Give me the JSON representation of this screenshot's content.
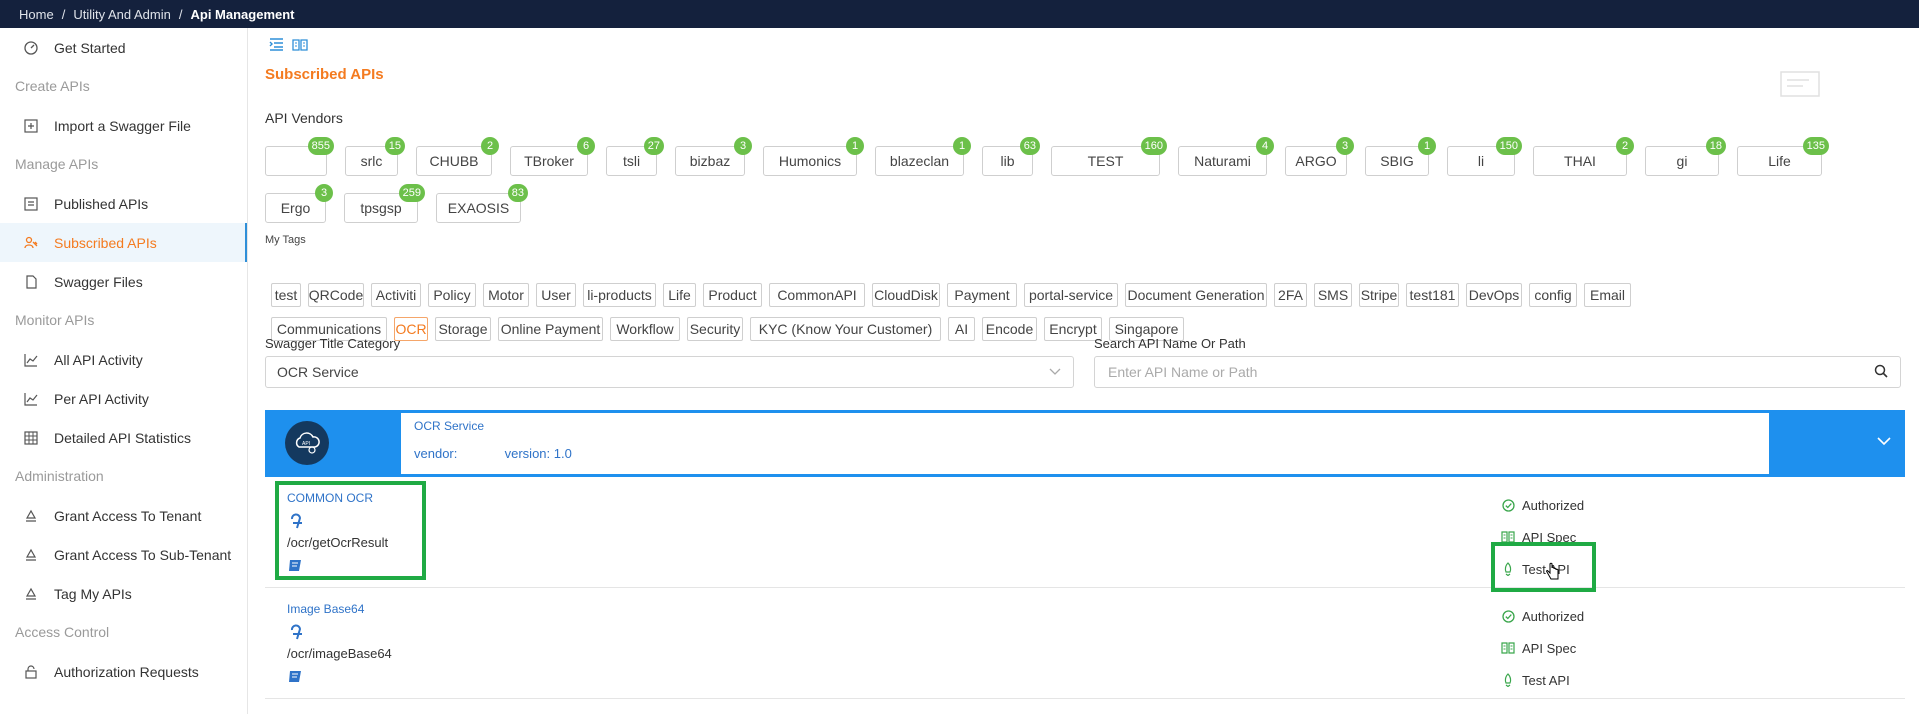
{
  "breadcrumb": {
    "items": [
      "Home",
      "Utility And Admin"
    ],
    "current": "Api Management",
    "separator": "/"
  },
  "sidebar": {
    "get_started": "Get Started",
    "sections": {
      "create": "Create APIs",
      "manage": "Manage APIs",
      "monitor": "Monitor APIs",
      "admin": "Administration",
      "access": "Access Control"
    },
    "items": {
      "import_swagger": "Import a Swagger File",
      "published": "Published APIs",
      "subscribed": "Subscribed APIs",
      "swagger_files": "Swagger Files",
      "all_activity": "All API Activity",
      "per_activity": "Per API Activity",
      "detailed_stats": "Detailed API Statistics",
      "grant_tenant": "Grant Access To Tenant",
      "grant_subtenant": "Grant Access To Sub-Tenant",
      "tag_apis": "Tag My APIs",
      "auth_requests": "Authorization Requests"
    },
    "active_item": "Subscribed APIs"
  },
  "main": {
    "title": "Subscribed APIs",
    "vendors_label": "API Vendors",
    "tags_label": "My Tags",
    "category_label": "Swagger Title Category",
    "category_value": "OCR Service",
    "search_label": "Search API Name Or Path",
    "search_placeholder": "Enter API Name or Path"
  },
  "vendors": [
    {
      "name": "",
      "count": "855"
    },
    {
      "name": "srlc",
      "count": "15"
    },
    {
      "name": "CHUBB",
      "count": "2"
    },
    {
      "name": "TBroker",
      "count": "6"
    },
    {
      "name": "tsli",
      "count": "27"
    },
    {
      "name": "bizbaz",
      "count": "3"
    },
    {
      "name": "Humonics",
      "count": "1"
    },
    {
      "name": "blazeclan",
      "count": "1"
    },
    {
      "name": "lib",
      "count": "63"
    },
    {
      "name": "TEST",
      "count": "160"
    },
    {
      "name": "Naturami",
      "count": "4"
    },
    {
      "name": "ARGO",
      "count": "3"
    },
    {
      "name": "SBIG",
      "count": "1"
    },
    {
      "name": "li",
      "count": "150"
    },
    {
      "name": "THAI",
      "count": "2"
    },
    {
      "name": "gi",
      "count": "18"
    },
    {
      "name": "Life",
      "count": "135"
    },
    {
      "name": "Ergo",
      "count": "3"
    },
    {
      "name": "tpsgsp",
      "count": "259"
    },
    {
      "name": "EXAOSIS",
      "count": "83"
    }
  ],
  "tags": [
    "test",
    "QRCode",
    "Activiti",
    "Policy",
    "Motor",
    "User",
    "li-products",
    "Life",
    "Product",
    "CommonAPI",
    "CloudDisk",
    "Payment",
    "portal-service",
    "Document Generation",
    "2FA",
    "SMS",
    "Stripe",
    "test181",
    "DevOps",
    "config",
    "Email",
    "Communications",
    "OCR",
    "Storage",
    "Online Payment",
    "Workflow",
    "Security",
    "KYC (Know Your Customer)",
    "AI",
    "Encode",
    "Encrypt",
    "Singapore"
  ],
  "selected_tag": "OCR",
  "service": {
    "name": "OCR Service",
    "vendor_label": "vendor:",
    "vendor_value": "",
    "version_label": "version: 1.0"
  },
  "apis": [
    {
      "name": "COMMON OCR",
      "path": "/ocr/getOcrResult",
      "actions": [
        "Authorized",
        "API Spec",
        "Test API"
      ]
    },
    {
      "name": "Image Base64",
      "path": "/ocr/imageBase64",
      "actions": [
        "Authorized",
        "API Spec",
        "Test API"
      ]
    }
  ],
  "colors": {
    "topbar": "#14213d",
    "accent_orange": "#f47b20",
    "accent_blue": "#1e90ee",
    "badge_green": "#6cc04a",
    "highlight_green": "#1faa44"
  }
}
